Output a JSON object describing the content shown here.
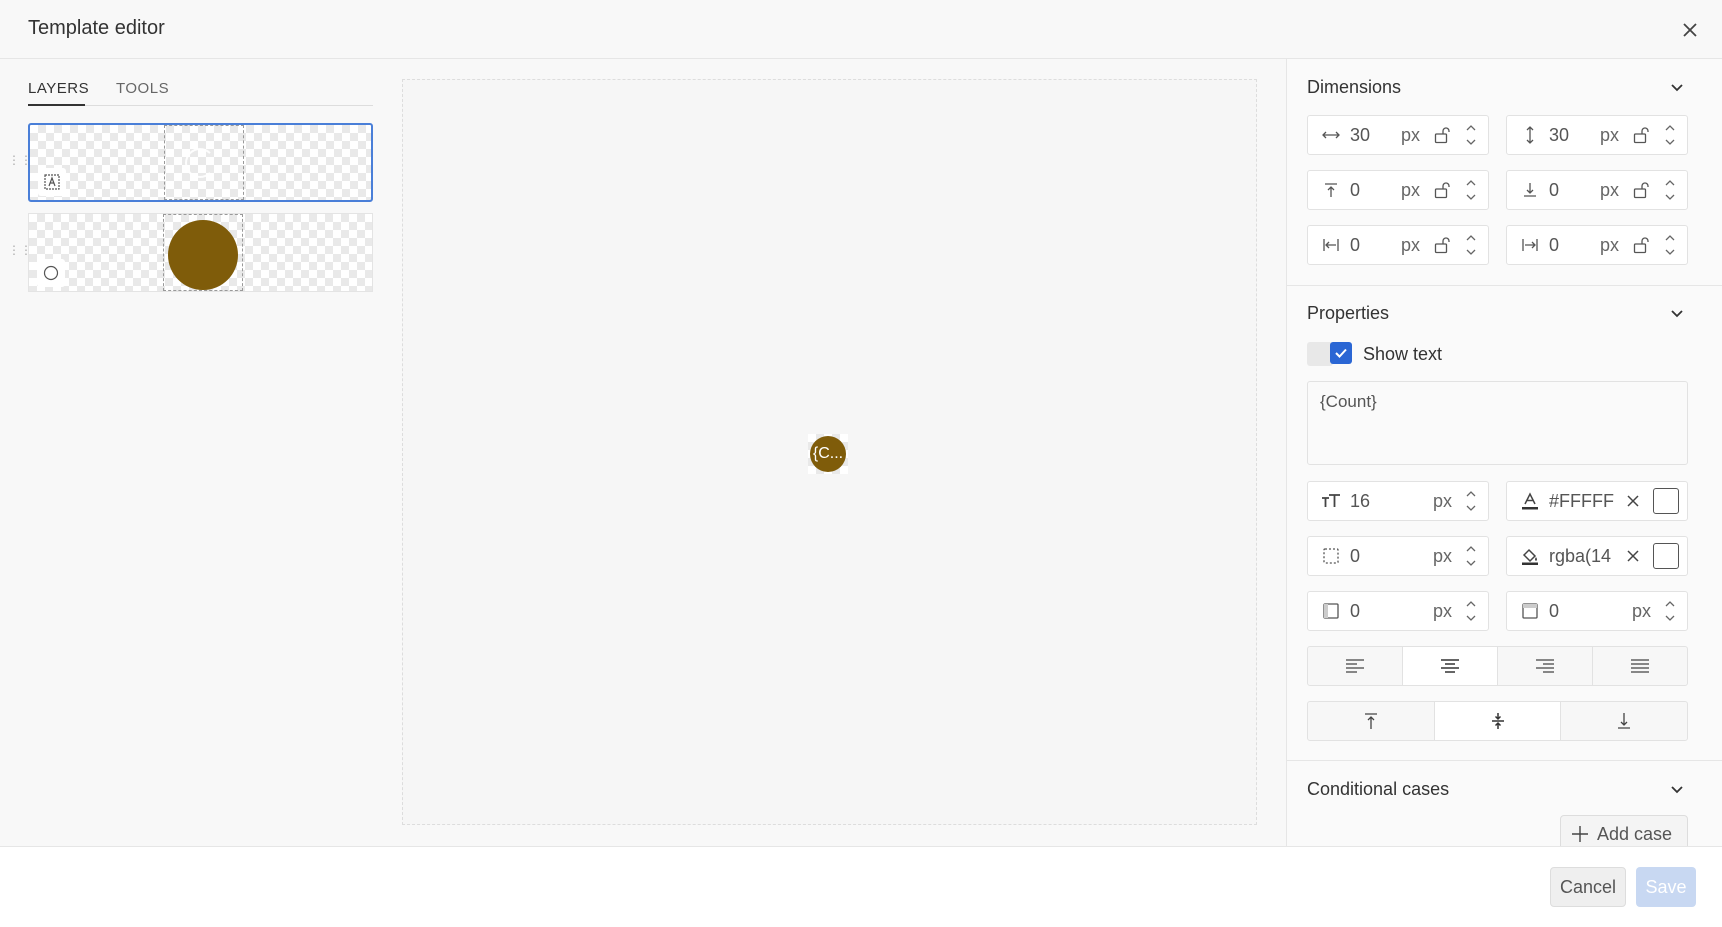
{
  "window": {
    "title": "Template editor"
  },
  "tabs": [
    {
      "label": "LAYERS",
      "active": true
    },
    {
      "label": "TOOLS",
      "active": false
    }
  ],
  "layers": [
    {
      "type": "text",
      "icon": "text-box-icon",
      "selected": true
    },
    {
      "type": "circle",
      "icon": "circle-icon",
      "selected": false,
      "color": "#7f5c0a"
    }
  ],
  "canvas": {
    "preview_text": "{C..."
  },
  "dimensions": {
    "title": "Dimensions",
    "width": {
      "value": "30",
      "unit": "px"
    },
    "height": {
      "value": "30",
      "unit": "px"
    },
    "offset_top": {
      "value": "0",
      "unit": "px"
    },
    "offset_bottom": {
      "value": "0",
      "unit": "px"
    },
    "offset_left": {
      "value": "0",
      "unit": "px"
    },
    "offset_right": {
      "value": "0",
      "unit": "px"
    }
  },
  "properties": {
    "title": "Properties",
    "show_text_label": "Show text",
    "show_text_checked": true,
    "text_value": "{Count}",
    "font_size": {
      "value": "16",
      "unit": "px"
    },
    "text_color": {
      "value": "#FFFFF",
      "swatch": "#FFFFFF"
    },
    "border": {
      "value": "0",
      "unit": "px"
    },
    "fill_color": {
      "value": "rgba(14"
    },
    "padding_left": {
      "value": "0",
      "unit": "px"
    },
    "padding_top": {
      "value": "0",
      "unit": "px"
    },
    "h_align": "center",
    "v_align": "middle"
  },
  "conditional": {
    "title": "Conditional cases",
    "add_label": "Add case"
  },
  "footer": {
    "cancel_label": "Cancel",
    "save_label": "Save"
  },
  "colors": {
    "accent": "#2a66d4",
    "selected_border": "#4a7fd8",
    "circle": "#7f5c0a"
  }
}
